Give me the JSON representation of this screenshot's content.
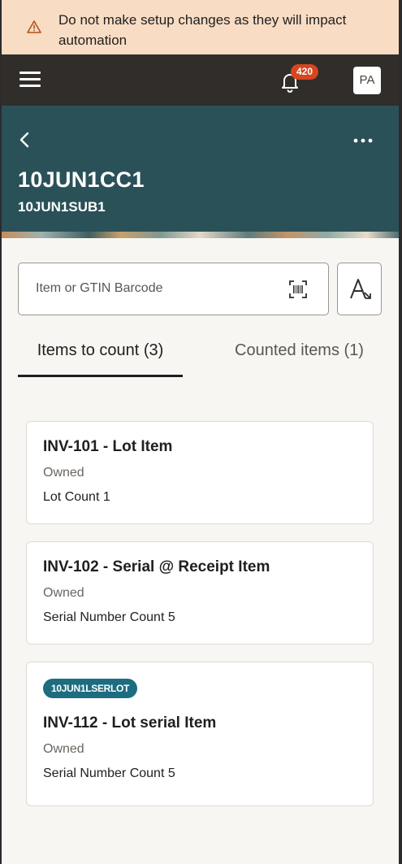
{
  "warning": {
    "text": "Do not make setup changes as they will impact automation"
  },
  "topbar": {
    "notification_count": "420",
    "avatar_initials": "PA"
  },
  "header": {
    "title": "10JUN1CC1",
    "subtitle": "10JUN1SUB1"
  },
  "search": {
    "placeholder": "Item or GTIN Barcode"
  },
  "tabs": [
    {
      "label": "Items to count (3)",
      "selected": true
    },
    {
      "label": "Counted items (1)",
      "selected": false
    }
  ],
  "items": [
    {
      "name": "INV-101 - Lot Item",
      "ownership": "Owned",
      "count_text": "Lot Count 1"
    },
    {
      "name": "INV-102 - Serial @ Receipt Item",
      "ownership": "Owned",
      "count_text": "Serial Number Count 5"
    },
    {
      "tag": "10JUN1LSERLOT",
      "name": "INV-112 - Lot serial Item",
      "ownership": "Owned",
      "count_text": "Serial Number Count 5"
    }
  ],
  "colors": {
    "warning_bg": "#f8dcc4",
    "topbar_bg": "#312d2a",
    "header_bg": "#2b5158",
    "badge_bg": "#d6461f",
    "tag_bg": "#1d6c80"
  }
}
